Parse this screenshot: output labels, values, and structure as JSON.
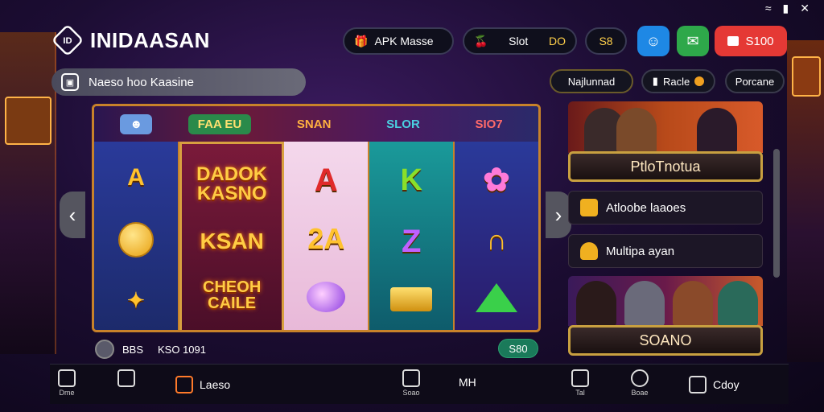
{
  "status_bar": {
    "wifi": "wifi-icon",
    "battery": "battery-icon",
    "close": "close-icon"
  },
  "brand": {
    "logo_mark": "ID",
    "title": "INIDAASAN"
  },
  "header": {
    "apk_label": "APK Masse",
    "slot_label": "Slot",
    "slot_value": "DO",
    "balance": "S8",
    "red_button_label": "S100",
    "colors": {
      "blue": "#1e88e5",
      "green": "#2ea84a",
      "red": "#e53935"
    }
  },
  "search": {
    "value": "Naeso hoo Kaasine"
  },
  "chips": {
    "first": "Najlunnad",
    "second": "Racle",
    "third": "Porcane"
  },
  "machine": {
    "top_symbols": [
      "",
      "FAA EU",
      "SNAN",
      "SLOR",
      "SIO7"
    ],
    "reels": [
      [
        "A",
        "",
        ""
      ],
      [
        "DADOK KASNO",
        "KSAN",
        "CHEOH CAILE"
      ],
      [
        "A",
        "2A",
        ""
      ],
      [
        "K",
        "Z",
        ""
      ],
      [
        "",
        "",
        ""
      ]
    ]
  },
  "bet": {
    "label": "BBS",
    "amount": "KSO 1091",
    "spin_label": "S80"
  },
  "promos": {
    "first_cta": "PtloTnotua",
    "list": [
      "Atloobe laaoes",
      "Multipa ayan"
    ],
    "second_cta": "SOANO"
  },
  "bottom_nav": {
    "items": [
      "Dme",
      "",
      "Laeso",
      "Soao",
      "MH",
      "Tal",
      "Boae",
      "Cdoy"
    ]
  }
}
